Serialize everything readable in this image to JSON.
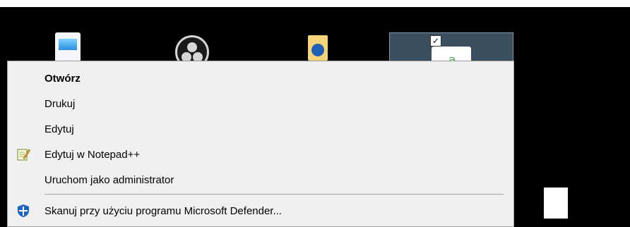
{
  "desktop": {
    "icons": [
      {
        "name": "document-icon"
      },
      {
        "name": "obs-icon"
      },
      {
        "name": "folder-icon"
      },
      {
        "name": "selected-file-icon",
        "checked": true
      }
    ]
  },
  "context_menu": {
    "items": [
      {
        "label": "Otwórz",
        "bold": true
      },
      {
        "label": "Drukuj"
      },
      {
        "label": "Edytuj"
      },
      {
        "label": "Edytuj w Notepad++",
        "icon": "notepad-plus-plus-icon"
      },
      {
        "label": "Uruchom jako administrator"
      },
      {
        "label": "Skanuj przy użyciu programu Microsoft Defender...",
        "icon": "microsoft-defender-icon"
      }
    ]
  },
  "colors": {
    "menu_bg": "#f0f0f0",
    "desktop_bg": "#000000",
    "selection": "#3a4e5e",
    "defender_blue": "#1e63c5"
  }
}
